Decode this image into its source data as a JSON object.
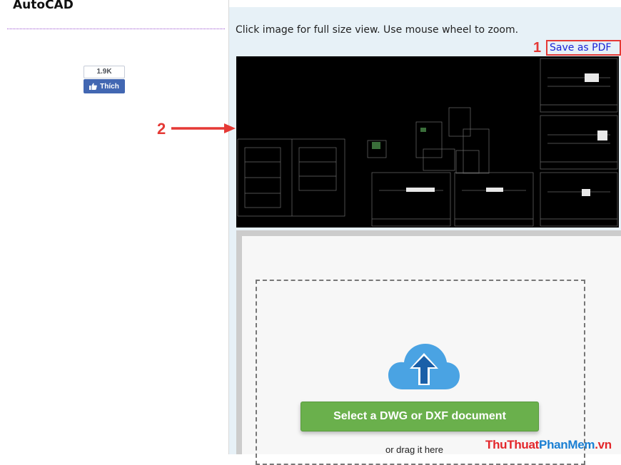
{
  "header": {
    "app_title": "AutoCAD"
  },
  "social": {
    "like_count": "1.9K",
    "like_label": "Thích"
  },
  "viewer": {
    "instruction": "Click image for full size view. Use mouse wheel to zoom.",
    "save_pdf_label": "Save as PDF"
  },
  "annotations": {
    "marker_1": "1",
    "marker_2": "2"
  },
  "upload": {
    "select_button_label": "Select a DWG or DXF document",
    "drag_text": "or drag it here"
  },
  "watermark": {
    "part1": "ThuThuat",
    "part2": "PhanMem",
    "part3": ".vn"
  },
  "colors": {
    "accent_red": "#e53935",
    "link_blue": "#1a24d6",
    "button_green": "#6ab04c",
    "facebook_blue": "#4267b2",
    "panel_bg": "#e7f1f7",
    "cloud_blue": "#4aa3e3"
  },
  "icons": [
    "thumbs-up-icon",
    "arrow-right-icon",
    "cloud-upload-icon"
  ]
}
